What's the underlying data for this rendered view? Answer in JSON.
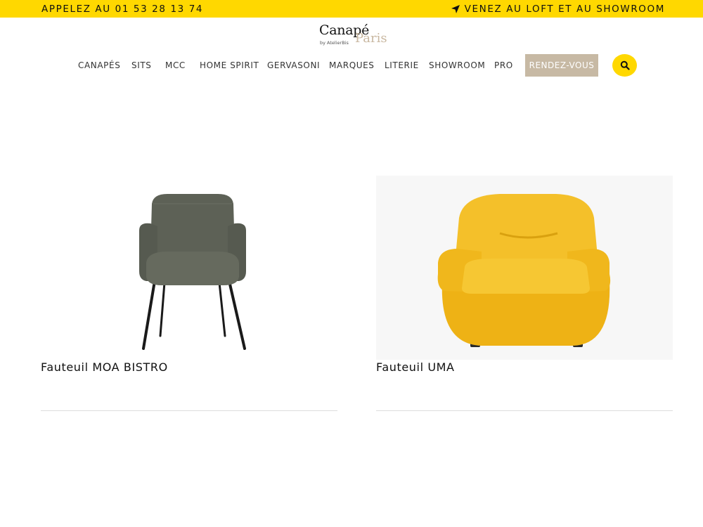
{
  "topbar": {
    "phone_text": "APPELEZ AU 01 53 28 13 74",
    "visit_text": "VENEZ AU LOFT ET AU SHOWROOM",
    "background": "#ffd800",
    "visit_icon": "location-arrow-icon"
  },
  "logo": {
    "brand": "Canapé",
    "city": "Paris",
    "byline": "by AtelierBis"
  },
  "nav": {
    "items": [
      "CANAPÉS",
      "SITS",
      "MCC",
      "HOME SPIRIT",
      "GERVASONI",
      "MARQUES",
      "LITERIE",
      "SHOWROOM",
      "PRO"
    ],
    "cta_label": "RENDEZ-VOUS",
    "cta_color": "#c7b9a4",
    "search_icon": "search-icon",
    "search_color": "#ffd800"
  },
  "products": [
    {
      "title": "Fauteuil MOA BISTRO",
      "color": "#5b5f55"
    },
    {
      "title": "Fauteuil UMA",
      "color": "#f2b81a"
    }
  ]
}
